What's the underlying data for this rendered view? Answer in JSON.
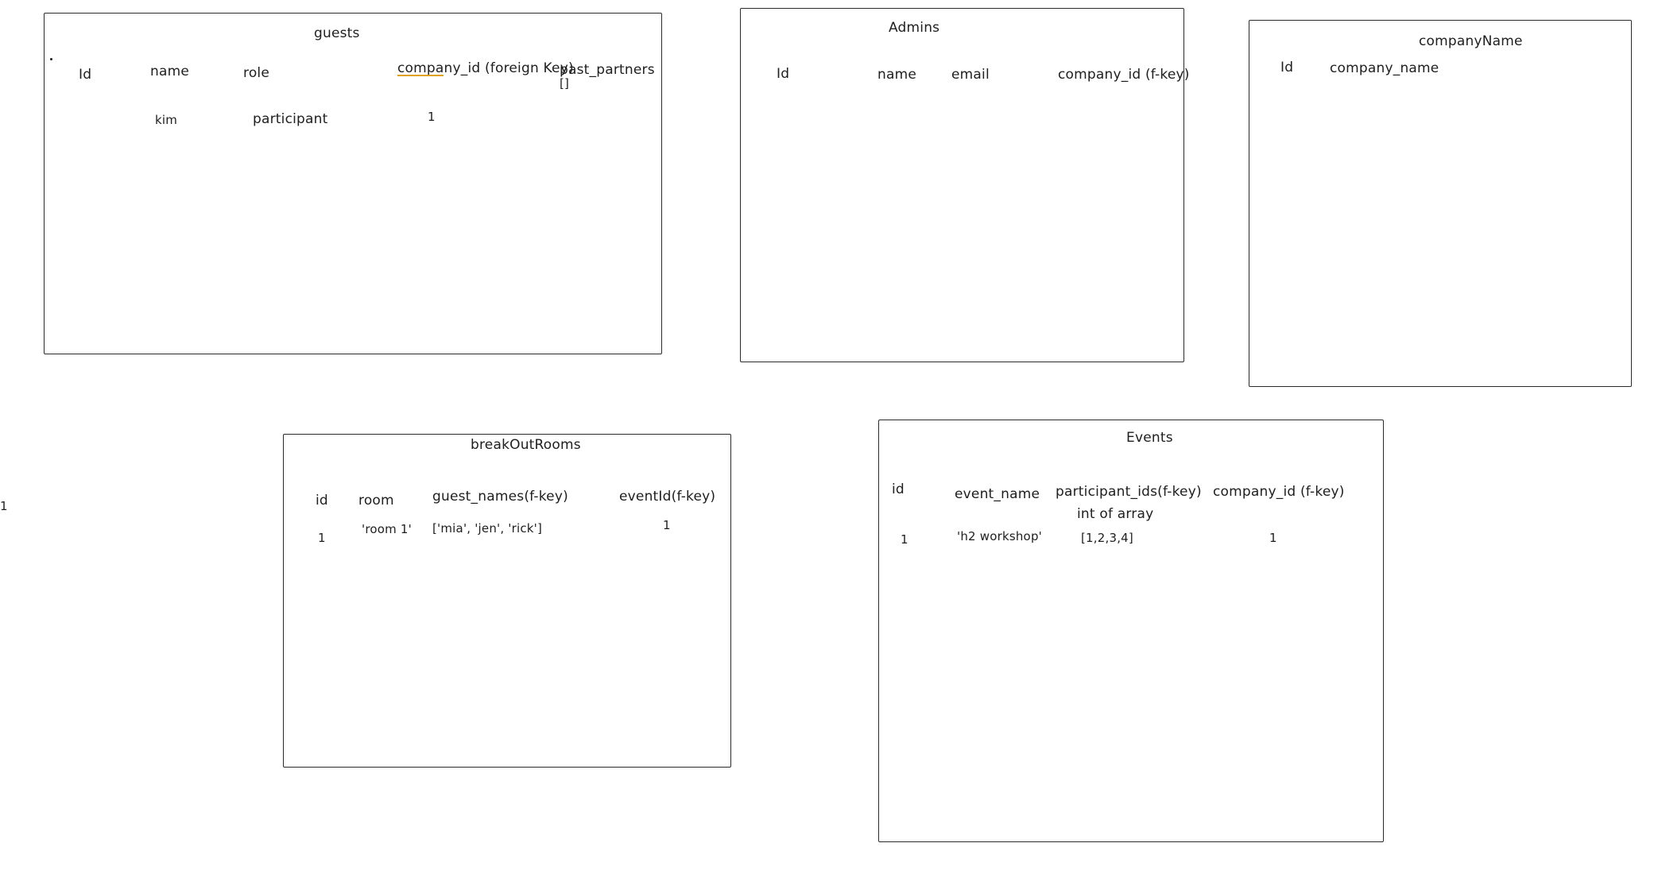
{
  "tables": {
    "guests": {
      "title": "guests",
      "headers": [
        "Id",
        "name",
        "role",
        "company_id (foreign Key)",
        "past_partners",
        "[]"
      ],
      "row": [
        "kim",
        "participant",
        "1"
      ]
    },
    "admins": {
      "title": "Admins",
      "headers": [
        "Id",
        "name",
        "email",
        "company_id (f-key)"
      ]
    },
    "company": {
      "title": "companyName",
      "headers": [
        "Id",
        "company_name"
      ]
    },
    "breakout": {
      "title": "breakOutRooms",
      "headers": [
        "id",
        "room",
        "guest_names(f-key)",
        "eventId(f-key)"
      ],
      "row": [
        "1",
        "'room 1'",
        "['mia', 'jen', 'rick']",
        "1"
      ]
    },
    "events": {
      "title": "Events",
      "headers": [
        "id",
        "event_name",
        "participant_ids(f-key)",
        "company_id (f-key)"
      ],
      "note": "int of array",
      "row": [
        "1",
        "'h2 workshop'",
        "[1,2,3,4]",
        "1"
      ]
    }
  },
  "stray": {
    "left_number": "1"
  },
  "colors": {
    "stroke": "#2b2b2b",
    "accent_underline": "#e0a21b"
  }
}
